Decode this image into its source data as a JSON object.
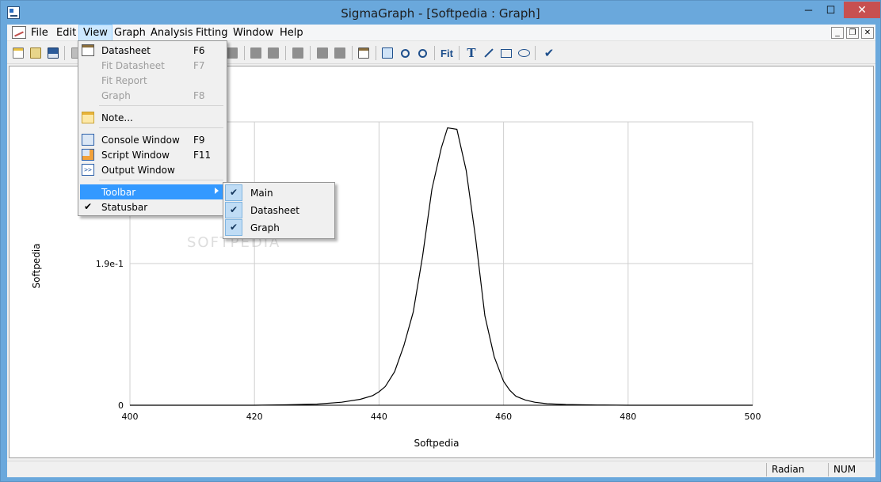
{
  "window": {
    "title": "SigmaGraph - [Softpedia : Graph]",
    "min_label": "─",
    "max_label": "☐",
    "close_label": "✕"
  },
  "menubar": {
    "items": [
      "File",
      "Edit",
      "View",
      "Graph",
      "Analysis",
      "Fitting",
      "Window",
      "Help"
    ],
    "mdi_min": "_",
    "mdi_restore": "❐",
    "mdi_close": "✕"
  },
  "view_menu": {
    "items": [
      {
        "label": "Datasheet",
        "key": "F6",
        "enabled": true,
        "icon": "datasheet-icon"
      },
      {
        "label": "Fit Datasheet",
        "key": "F7",
        "enabled": false
      },
      {
        "label": "Fit Report",
        "key": "",
        "enabled": false
      },
      {
        "label": "Graph",
        "key": "F8",
        "enabled": false
      },
      {
        "label": "Note...",
        "key": "",
        "enabled": true,
        "icon": "note-icon"
      },
      {
        "label": "Console Window",
        "key": "F9",
        "enabled": true,
        "icon": "console-icon"
      },
      {
        "label": "Script Window",
        "key": "F11",
        "enabled": true,
        "icon": "script-icon"
      },
      {
        "label": "Output Window",
        "key": "",
        "enabled": true,
        "icon": "output-icon"
      },
      {
        "label": "Toolbar",
        "key": "",
        "enabled": true,
        "highlighted": true
      },
      {
        "label": "Statusbar",
        "key": "",
        "enabled": true,
        "checked": true
      }
    ],
    "check_glyph": "✔"
  },
  "toolbar_submenu": {
    "items": [
      {
        "label": "Main",
        "checked": true
      },
      {
        "label": "Datasheet",
        "checked": true
      },
      {
        "label": "Graph",
        "checked": true
      }
    ],
    "check_glyph": "✔"
  },
  "toolbar": {
    "fit_label": "Fit",
    "text_label": "T"
  },
  "watermark": "SOFTPEDIA",
  "statusbar": {
    "mode": "Radian",
    "num": "NUM"
  },
  "colors": {
    "highlight": "#3399ff",
    "titlebar": "#6aa8dc",
    "close": "#c75050"
  },
  "chart_data": {
    "type": "line",
    "xlabel": "Softpedia",
    "ylabel": "Softpedia",
    "xlim": [
      400,
      500
    ],
    "ylim": [
      0,
      0.38
    ],
    "x_ticks": [
      "400",
      "420",
      "440",
      "460",
      "480",
      "500"
    ],
    "y_ticks": [
      "0",
      "1.9e-1"
    ],
    "grid": true,
    "series": [
      {
        "x": [
          400,
          420,
          425,
          430,
          434,
          437,
          439,
          440,
          441,
          442.5,
          444,
          445.5,
          447,
          448.5,
          450,
          451,
          452.5,
          454,
          455.5,
          457,
          458.5,
          460,
          461,
          462,
          463.5,
          465,
          467,
          470,
          475,
          480,
          500
        ],
        "y": [
          0,
          0,
          0.0005,
          0.0015,
          0.004,
          0.008,
          0.013,
          0.018,
          0.025,
          0.045,
          0.08,
          0.125,
          0.2,
          0.29,
          0.345,
          0.372,
          0.37,
          0.315,
          0.225,
          0.12,
          0.065,
          0.032,
          0.02,
          0.012,
          0.007,
          0.004,
          0.002,
          0.001,
          0.0003,
          0,
          0
        ]
      }
    ]
  }
}
